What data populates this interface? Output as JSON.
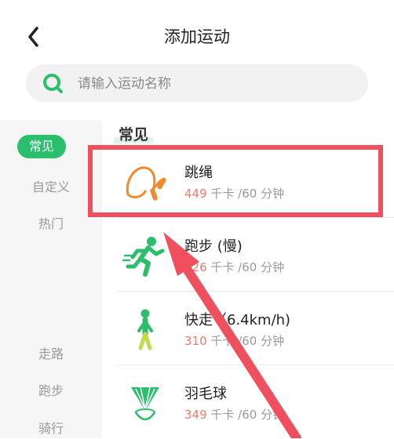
{
  "header": {
    "title": "添加运动"
  },
  "search": {
    "placeholder": "请输入运动名称"
  },
  "sidebar": {
    "items": [
      {
        "label": "常见",
        "active": true
      },
      {
        "label": "自定义"
      },
      {
        "label": "热门"
      },
      {
        "label": "走路"
      },
      {
        "label": "跑步"
      },
      {
        "label": "骑行"
      }
    ]
  },
  "section": {
    "title": "常见"
  },
  "activities": [
    {
      "name": "跳绳",
      "kcal": "449",
      "rest": " 千卡 /60 分钟",
      "icon": "jump-rope-icon"
    },
    {
      "name": "跑步 (慢)",
      "kcal": "426",
      "rest": " 千卡 /60 分钟",
      "icon": "running-person-icon"
    },
    {
      "name": "快走（6.4km/h)",
      "kcal": "310",
      "rest": " 千卡 /60 分钟",
      "icon": "walking-person-icon"
    },
    {
      "name": "羽毛球",
      "kcal": "349",
      "rest": " 千卡 /60 分钟",
      "icon": "shuttlecock-icon"
    }
  ],
  "colors": {
    "accent_green": "#2bbf6d",
    "highlight_red": "#f0505e",
    "kcal_red": "#f07a6e",
    "jump_rope_orange": "#f08a2a",
    "activity_green": "#2bbf6d"
  }
}
